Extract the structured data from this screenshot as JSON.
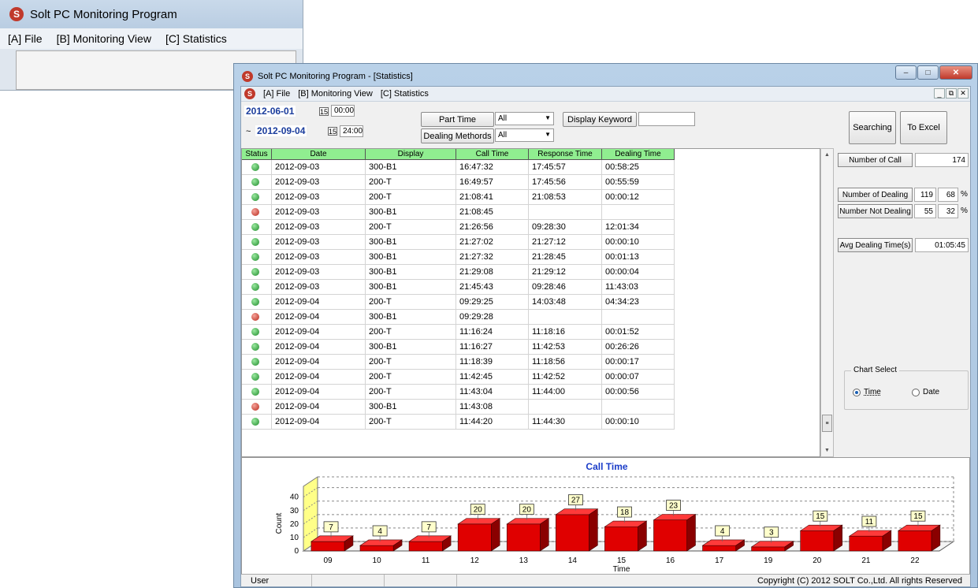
{
  "bg_window": {
    "title": "Solt PC Monitoring Program",
    "menu": [
      "[A] File",
      "[B] Monitoring View",
      "[C] Statistics"
    ]
  },
  "window": {
    "title": "Solt PC Monitoring Program - [Statistics]",
    "menu": [
      "[A] File",
      "[B] Monitoring View",
      "[C] Statistics"
    ],
    "mdi_controls": [
      "_",
      "̅",
      "x"
    ]
  },
  "filter": {
    "start_date": "2012-06-01",
    "start_time": "00:00",
    "tilde": "~",
    "end_date": "2012-09-04",
    "end_time": "24:00",
    "part_time_label": "Part Time",
    "part_time_value": "All",
    "dealing_methods_label": "Dealing Methords",
    "dealing_methods_value": "All",
    "display_keyword_label": "Display Keyword",
    "display_keyword_value": "",
    "search_button": "Searching",
    "excel_button": "To Excel"
  },
  "table": {
    "columns": [
      "Status",
      "Date",
      "Display",
      "Call Time",
      "Response Time",
      "Dealing Time"
    ],
    "rows": [
      {
        "status": "green",
        "date": "2012-09-03",
        "display": "300-B1",
        "call": "16:47:32",
        "resp": "17:45:57",
        "deal": "00:58:25"
      },
      {
        "status": "green",
        "date": "2012-09-03",
        "display": "200-T",
        "call": "16:49:57",
        "resp": "17:45:56",
        "deal": "00:55:59"
      },
      {
        "status": "green",
        "date": "2012-09-03",
        "display": "200-T",
        "call": "21:08:41",
        "resp": "21:08:53",
        "deal": "00:00:12"
      },
      {
        "status": "red",
        "date": "2012-09-03",
        "display": "300-B1",
        "call": "21:08:45",
        "resp": "",
        "deal": ""
      },
      {
        "status": "green",
        "date": "2012-09-03",
        "display": "200-T",
        "call": "21:26:56",
        "resp": "09:28:30",
        "deal": "12:01:34"
      },
      {
        "status": "green",
        "date": "2012-09-03",
        "display": "300-B1",
        "call": "21:27:02",
        "resp": "21:27:12",
        "deal": "00:00:10"
      },
      {
        "status": "green",
        "date": "2012-09-03",
        "display": "300-B1",
        "call": "21:27:32",
        "resp": "21:28:45",
        "deal": "00:01:13"
      },
      {
        "status": "green",
        "date": "2012-09-03",
        "display": "300-B1",
        "call": "21:29:08",
        "resp": "21:29:12",
        "deal": "00:00:04"
      },
      {
        "status": "green",
        "date": "2012-09-03",
        "display": "300-B1",
        "call": "21:45:43",
        "resp": "09:28:46",
        "deal": "11:43:03"
      },
      {
        "status": "green",
        "date": "2012-09-04",
        "display": "200-T",
        "call": "09:29:25",
        "resp": "14:03:48",
        "deal": "04:34:23"
      },
      {
        "status": "red",
        "date": "2012-09-04",
        "display": "300-B1",
        "call": "09:29:28",
        "resp": "",
        "deal": ""
      },
      {
        "status": "green",
        "date": "2012-09-04",
        "display": "200-T",
        "call": "11:16:24",
        "resp": "11:18:16",
        "deal": "00:01:52"
      },
      {
        "status": "green",
        "date": "2012-09-04",
        "display": "300-B1",
        "call": "11:16:27",
        "resp": "11:42:53",
        "deal": "00:26:26"
      },
      {
        "status": "green",
        "date": "2012-09-04",
        "display": "200-T",
        "call": "11:18:39",
        "resp": "11:18:56",
        "deal": "00:00:17"
      },
      {
        "status": "green",
        "date": "2012-09-04",
        "display": "200-T",
        "call": "11:42:45",
        "resp": "11:42:52",
        "deal": "00:00:07"
      },
      {
        "status": "green",
        "date": "2012-09-04",
        "display": "200-T",
        "call": "11:43:04",
        "resp": "11:44:00",
        "deal": "00:00:56"
      },
      {
        "status": "red",
        "date": "2012-09-04",
        "display": "300-B1",
        "call": "11:43:08",
        "resp": "",
        "deal": ""
      },
      {
        "status": "green",
        "date": "2012-09-04",
        "display": "200-T",
        "call": "11:44:20",
        "resp": "11:44:30",
        "deal": "00:00:10"
      }
    ]
  },
  "stats": {
    "number_of_call_label": "Number of Call",
    "number_of_call": "174",
    "number_dealing_label": "Number of Dealing",
    "number_dealing": "119",
    "number_dealing_pct": "68",
    "number_not_dealing_label": "Number Not Dealing",
    "number_not_dealing": "55",
    "number_not_dealing_pct": "32",
    "pct_sign": "%",
    "avg_label": "Avg Dealing Time(s)",
    "avg_value": "01:05:45"
  },
  "chart_select": {
    "label": "Chart Select",
    "options": [
      "Time",
      "Date"
    ],
    "selected": "Time"
  },
  "chart_data": {
    "type": "bar",
    "title": "Call Time",
    "xlabel": "Time",
    "ylabel": "Count",
    "categories": [
      "09",
      "10",
      "11",
      "12",
      "13",
      "14",
      "15",
      "16",
      "17",
      "19",
      "20",
      "21",
      "22"
    ],
    "values": [
      7,
      4,
      7,
      20,
      20,
      27,
      18,
      23,
      4,
      3,
      15,
      11,
      15
    ],
    "yticks": [
      "0",
      "10",
      "20",
      "30",
      "40"
    ],
    "ylim": [
      0,
      40
    ],
    "bar_color": "#e00000",
    "title_color": "#1a3cc8"
  },
  "statusbar": {
    "user": "User",
    "copyright": "Copyright (C) 2012 SOLT Co.,Ltd. All rights Reserved"
  }
}
